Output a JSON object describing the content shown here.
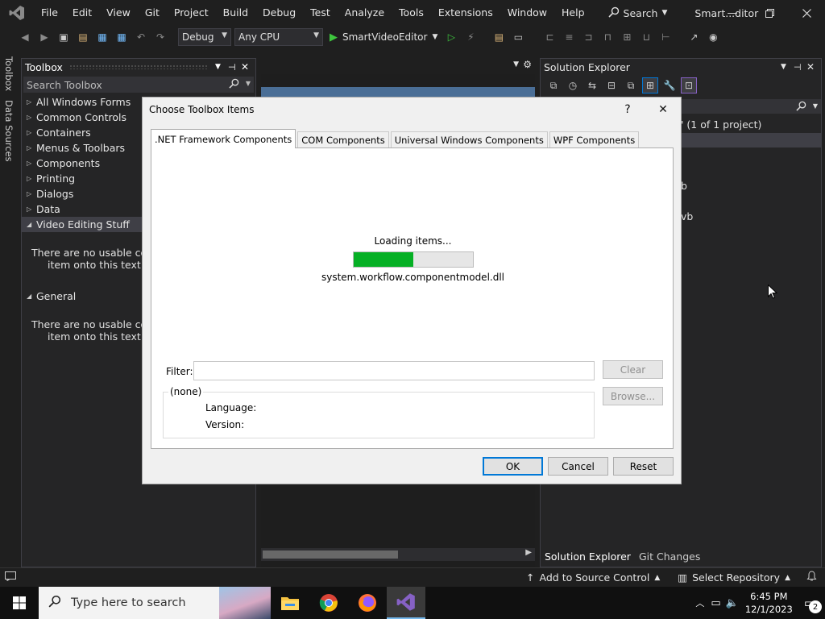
{
  "menubar": {
    "items": [
      "File",
      "Edit",
      "View",
      "Git",
      "Project",
      "Build",
      "Debug",
      "Test",
      "Analyze",
      "Tools",
      "Extensions",
      "Window",
      "Help"
    ],
    "search_label": "Search",
    "solution_name": "Smart...ditor"
  },
  "toolbar": {
    "config": "Debug",
    "platform": "Any CPU",
    "startup_project": "SmartVideoEditor"
  },
  "vstrip": {
    "tabs": [
      "Toolbox",
      "Data Sources"
    ]
  },
  "toolbox": {
    "title": "Toolbox",
    "search_placeholder": "Search Toolbox",
    "categories": [
      "All Windows Forms",
      "Common Controls",
      "Containers",
      "Menus & Toolbars",
      "Components",
      "Printing",
      "Dialogs",
      "Data"
    ],
    "expanded1": "Video Editing Stuff",
    "note1_line1": "There are no usable contro",
    "note1_line2": "item onto this text to a",
    "expanded2": "General",
    "note2_line1": "There are no usable contro",
    "note2_line2": "item onto this text to a"
  },
  "solexp": {
    "title": "Solution Explorer",
    "project_count": "' (1 of 1 project)",
    "item1": "b",
    "item2": "vb",
    "tab_active": "Solution Explorer",
    "tab_other": "Git Changes"
  },
  "dialog": {
    "title": "Choose Toolbox Items",
    "help": "?",
    "close": "✕",
    "tabs": [
      ".NET Framework Components",
      "COM Components",
      "Universal Windows Components",
      "WPF Components"
    ],
    "loading_text": "Loading items...",
    "progress": 0.5,
    "loading_file": "system.workflow.componentmodel.dll",
    "filter_label": "Filter:",
    "filter_value": "",
    "clear": "Clear",
    "browse": "Browse...",
    "info_none": "(none)",
    "language_label": "Language:",
    "version_label": "Version:",
    "ok": "OK",
    "cancel": "Cancel",
    "reset": "Reset"
  },
  "statusbar": {
    "source_control": "Add to Source Control",
    "repository": "Select Repository"
  },
  "taskbar": {
    "search_placeholder": "Type here to search",
    "time": "6:45 PM",
    "date": "12/1/2023",
    "notif_count": "2"
  },
  "colors": {
    "accent": "#0078d7",
    "progress": "#06b025",
    "vs_purple": "#8661c5"
  }
}
